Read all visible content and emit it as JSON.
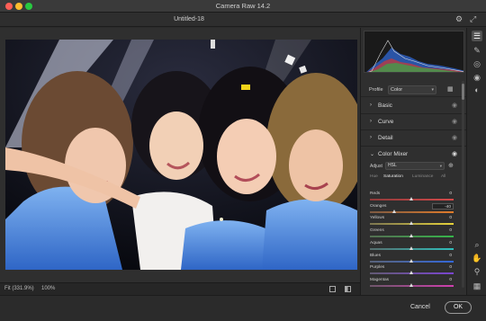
{
  "app": {
    "title": "Camera Raw 14.2"
  },
  "document": {
    "title": "Untitled-18"
  },
  "icons": {
    "settings": "gear-icon",
    "fullscreen": "expand-icon"
  },
  "canvas": {
    "fit_label": "Fit (331.9%)",
    "zoom_label": "100%"
  },
  "footer": {
    "cancel_label": "Cancel",
    "ok_label": "OK"
  },
  "panel": {
    "profile_label": "Profile",
    "profile_value": "Color",
    "sections": [
      {
        "name": "Basic"
      },
      {
        "name": "Curve"
      },
      {
        "name": "Detail"
      },
      {
        "name": "Color Mixer"
      }
    ],
    "adjust_label": "Adjust",
    "adjust_value": "HSL",
    "tabs": [
      "Hue",
      "Saturation",
      "Luminance",
      "All"
    ],
    "active_tab": "Saturation",
    "sliders": [
      {
        "label": "Reds",
        "value": "0",
        "amount": 0
      },
      {
        "label": "Oranges",
        "value": "-40",
        "amount": -40
      },
      {
        "label": "Yellows",
        "value": "0",
        "amount": 0
      },
      {
        "label": "Greens",
        "value": "0",
        "amount": 0
      },
      {
        "label": "Aquas",
        "value": "0",
        "amount": 0
      },
      {
        "label": "Blues",
        "value": "0",
        "amount": 0
      },
      {
        "label": "Purples",
        "value": "0",
        "amount": 0
      },
      {
        "label": "Magentas",
        "value": "0",
        "amount": 0
      }
    ]
  },
  "colors": {
    "reds": "#c23b3b",
    "oranges": "#d47a2c",
    "yellows": "#d6c63a",
    "greens": "#3fae4a",
    "aquas": "#3fb6b4",
    "blues": "#3c6fd0",
    "purples": "#7a4cc6",
    "magentas": "#c545a6",
    "ok_border": "#9a9a9a"
  },
  "toolbar": [
    "sliders-icon",
    "healing-brush-icon",
    "masking-icon",
    "red-eye-icon",
    "presets-icon",
    "zoom-icon",
    "hand-icon",
    "color-sampler-icon",
    "grid-icon"
  ]
}
